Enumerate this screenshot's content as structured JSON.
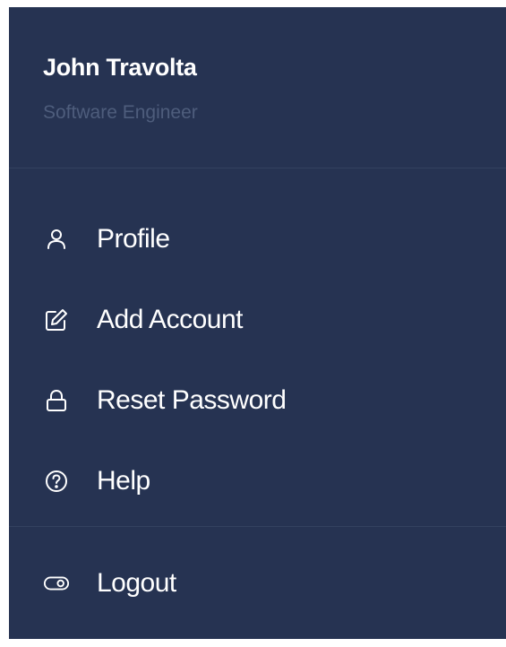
{
  "user": {
    "name": "John Travolta",
    "role": "Software Engineer"
  },
  "menu": {
    "items": [
      {
        "label": "Profile",
        "icon": "user-icon"
      },
      {
        "label": "Add Account",
        "icon": "edit-icon"
      },
      {
        "label": "Reset Password",
        "icon": "lock-icon"
      },
      {
        "label": "Help",
        "icon": "help-circle-icon"
      }
    ],
    "logout": {
      "label": "Logout",
      "icon": "toggle-icon"
    }
  },
  "colors": {
    "panel_bg": "#263352",
    "text": "#ffffff",
    "muted_text": "#4e5d7c",
    "divider": "#33415f"
  }
}
